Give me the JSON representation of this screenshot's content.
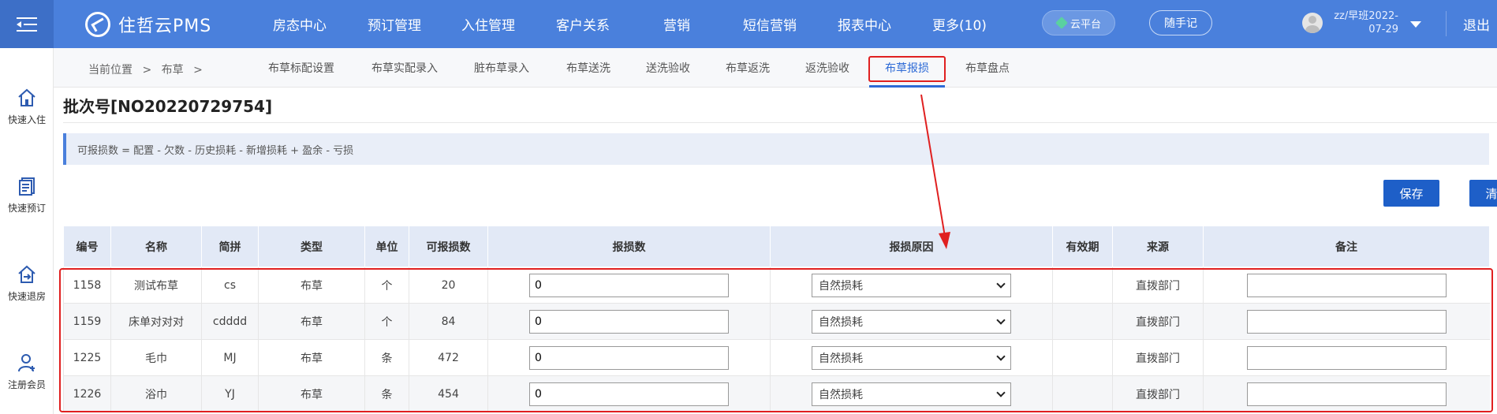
{
  "app": {
    "brand": "住哲云PMS"
  },
  "nav": [
    "房态中心",
    "预订管理",
    "入住管理",
    "客户关系",
    "营销",
    "短信营销",
    "报表中心",
    "更多(10)"
  ],
  "header": {
    "cloud_label": "云平台",
    "notes_label": "随手记",
    "user_line1": "zz/早班2022-",
    "user_line2": "07-29",
    "logout_label": "退出"
  },
  "sidebar": [
    "快速入住",
    "快速预订",
    "快速退房",
    "注册会员"
  ],
  "breadcrumb": {
    "current": "当前位置",
    "sep": ">",
    "section": "布草",
    "sep2": ">"
  },
  "subtabs": [
    "布草标配设置",
    "布草实配录入",
    "脏布草录入",
    "布草送洗",
    "送洗验收",
    "布草返洗",
    "返洗验收",
    "布草报损",
    "布草盘点"
  ],
  "active_subtab": "布草报损",
  "batch_title": "批次号[NO20220729754]",
  "formula": "可报损数 = 配置 - 欠数 - 历史损耗 - 新增损耗 + 盈余 - 亏损",
  "buttons": {
    "save": "保存",
    "clear": "清除"
  },
  "table": {
    "headers": [
      "编号",
      "名称",
      "简拼",
      "类型",
      "单位",
      "可报损数",
      "报损数",
      "报损原因",
      "有效期",
      "来源",
      "备注"
    ],
    "rows": [
      {
        "id": "1158",
        "name": "测试布草",
        "abbr": "cs",
        "type": "布草",
        "unit": "个",
        "available": "20",
        "qty": "0",
        "reason": "自然损耗",
        "expiry": "",
        "source": "直拨部门",
        "note": ""
      },
      {
        "id": "1159",
        "name": "床单对对对",
        "abbr": "cdddd",
        "type": "布草",
        "unit": "个",
        "available": "84",
        "qty": "0",
        "reason": "自然损耗",
        "expiry": "",
        "source": "直拨部门",
        "note": ""
      },
      {
        "id": "1225",
        "name": "毛巾",
        "abbr": "MJ",
        "type": "布草",
        "unit": "条",
        "available": "472",
        "qty": "0",
        "reason": "自然损耗",
        "expiry": "",
        "source": "直拨部门",
        "note": ""
      },
      {
        "id": "1226",
        "name": "浴巾",
        "abbr": "YJ",
        "type": "布草",
        "unit": "条",
        "available": "454",
        "qty": "0",
        "reason": "自然损耗",
        "expiry": "",
        "source": "直拨部门",
        "note": ""
      }
    ]
  },
  "colors": {
    "header_blue": "#4a80dc",
    "accent": "#1e5fc8",
    "annotation_red": "#e02020"
  }
}
